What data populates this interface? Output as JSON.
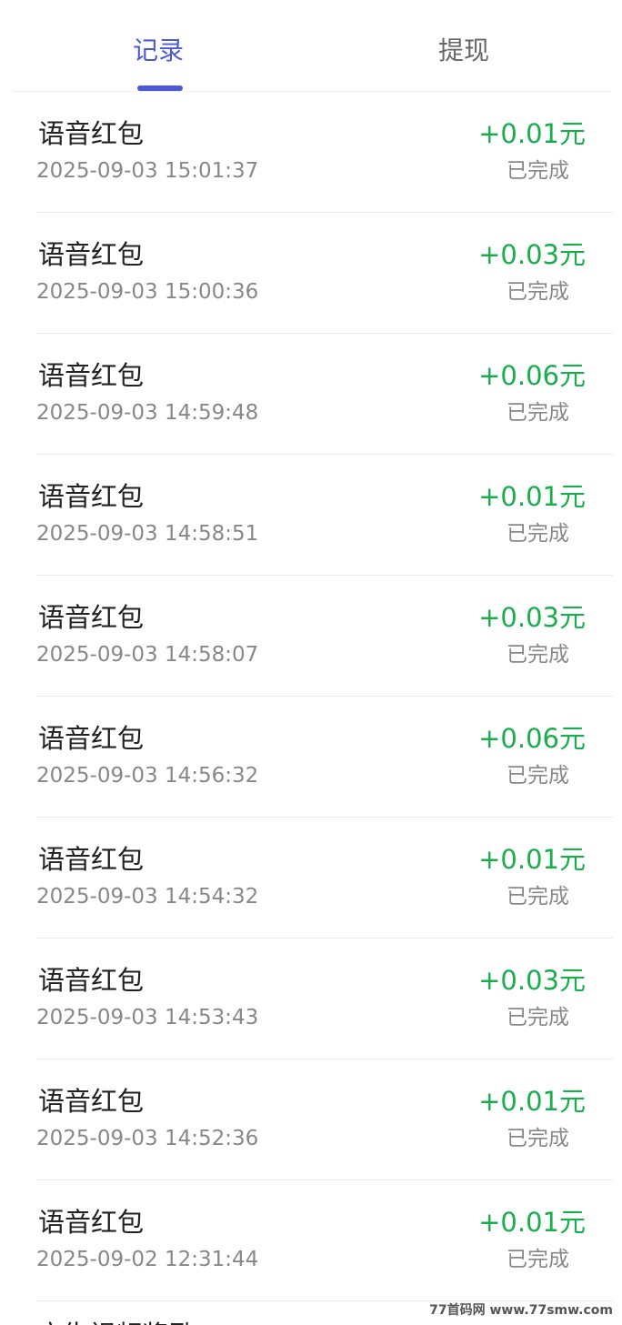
{
  "tabs": [
    {
      "label": "记录"
    },
    {
      "label": "提现"
    }
  ],
  "records": [
    {
      "title": "语音红包",
      "time": "2025-09-03 15:01:37",
      "amount": "+0.01元",
      "status": "已完成"
    },
    {
      "title": "语音红包",
      "time": "2025-09-03 15:00:36",
      "amount": "+0.03元",
      "status": "已完成"
    },
    {
      "title": "语音红包",
      "time": "2025-09-03 14:59:48",
      "amount": "+0.06元",
      "status": "已完成"
    },
    {
      "title": "语音红包",
      "time": "2025-09-03 14:58:51",
      "amount": "+0.01元",
      "status": "已完成"
    },
    {
      "title": "语音红包",
      "time": "2025-09-03 14:58:07",
      "amount": "+0.03元",
      "status": "已完成"
    },
    {
      "title": "语音红包",
      "time": "2025-09-03 14:56:32",
      "amount": "+0.06元",
      "status": "已完成"
    },
    {
      "title": "语音红包",
      "time": "2025-09-03 14:54:32",
      "amount": "+0.01元",
      "status": "已完成"
    },
    {
      "title": "语音红包",
      "time": "2025-09-03 14:53:43",
      "amount": "+0.03元",
      "status": "已完成"
    },
    {
      "title": "语音红包",
      "time": "2025-09-03 14:52:36",
      "amount": "+0.01元",
      "status": "已完成"
    },
    {
      "title": "语音红包",
      "time": "2025-09-02 12:31:44",
      "amount": "+0.01元",
      "status": "已完成"
    }
  ],
  "partial_row": {
    "title": "广告视频奖励"
  },
  "watermark": "77首码网 www.77smw.com",
  "colors": {
    "accent": "#4a5bd4",
    "amount": "#1aad4d",
    "muted": "#888888"
  }
}
